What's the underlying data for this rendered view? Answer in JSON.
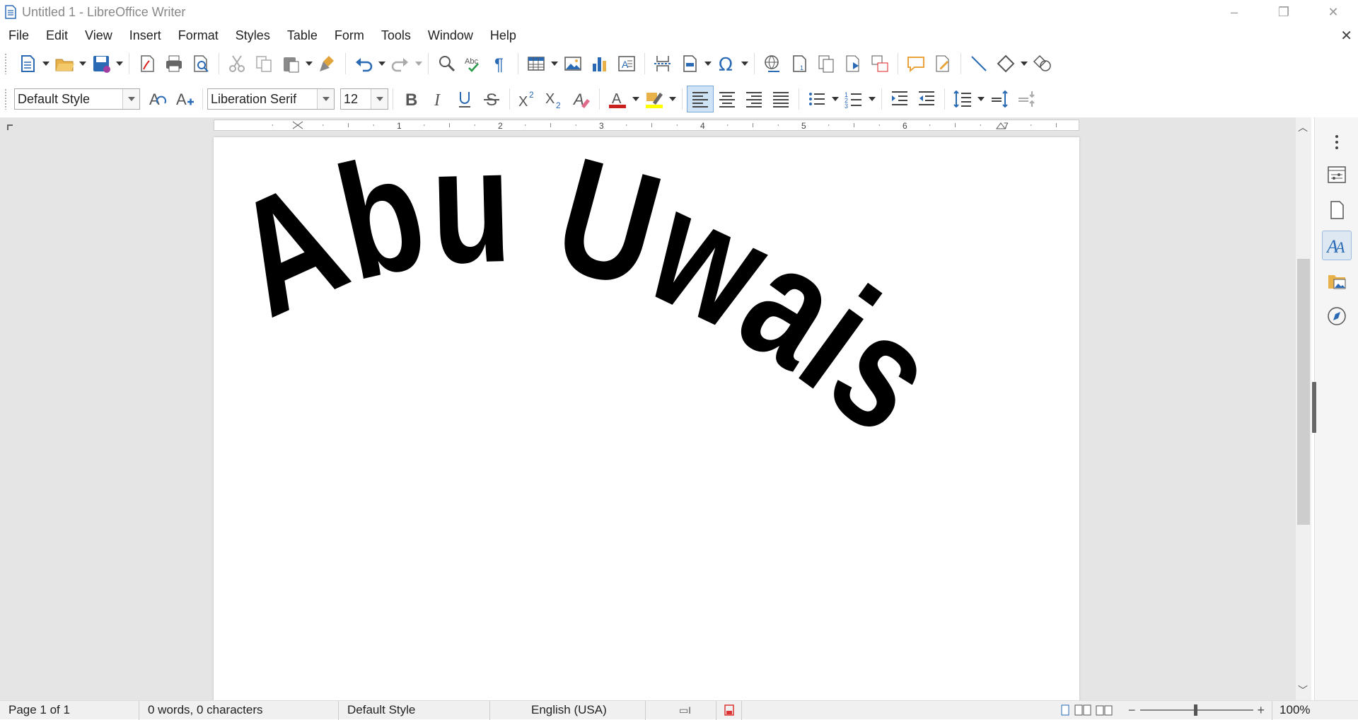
{
  "window": {
    "title": "Untitled 1 - LibreOffice Writer",
    "minimize_label": "–",
    "maximize_label": "❐",
    "close_label": "✕"
  },
  "menu": [
    "File",
    "Edit",
    "View",
    "Insert",
    "Format",
    "Styles",
    "Table",
    "Form",
    "Tools",
    "Window",
    "Help"
  ],
  "formatting": {
    "paragraph_style": "Default Style",
    "font_name": "Liberation Serif",
    "font_size": "12"
  },
  "ruler": {
    "ticks": [
      "1",
      "2",
      "3",
      "4",
      "5",
      "6",
      "7"
    ]
  },
  "document": {
    "fontwork_text": "Abu Uwais"
  },
  "statusbar": {
    "page": "Page 1 of 1",
    "word_count": "0 words, 0 characters",
    "page_style": "Default Style",
    "language": "English (USA)",
    "zoom": "100%"
  },
  "colors": {
    "font_color_bar": "#c9211e",
    "highlight_color_bar": "#ffff00",
    "accent": "#3a6fb0"
  }
}
